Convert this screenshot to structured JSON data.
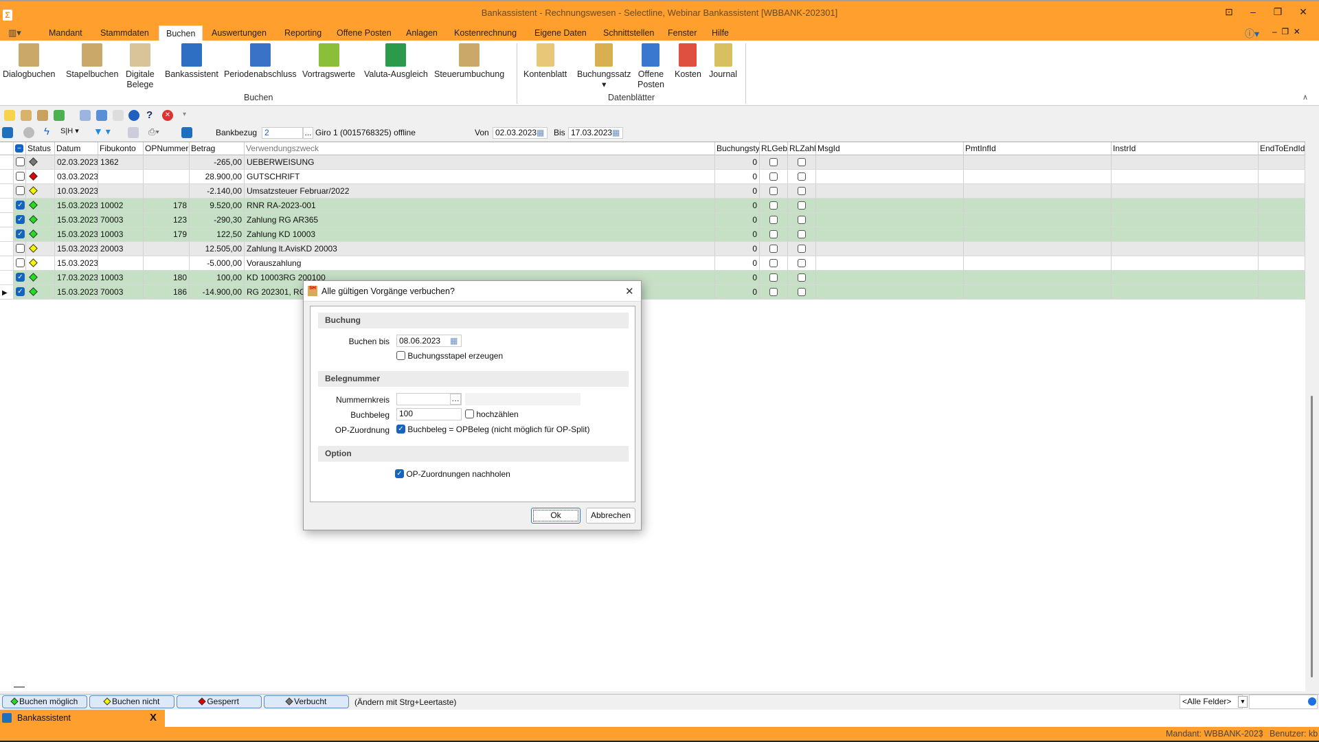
{
  "window": {
    "title": "Bankassistent - Rechnungswesen - Selectline, Webinar Bankassistent [WBBANK-202301]"
  },
  "menu": [
    "Mandant",
    "Stammdaten",
    "Buchen",
    "Auswertungen",
    "Reporting",
    "Offene Posten",
    "Anlagen",
    "Kostenrechnung",
    "Eigene Daten",
    "Schnittstellen",
    "Fenster",
    "Hilfe"
  ],
  "menu_active": "Buchen",
  "ribbon": {
    "buchen": [
      {
        "l1": "Dialogbuchen",
        "l2": ""
      },
      {
        "l1": "Stapelbuchen",
        "l2": ""
      },
      {
        "l1": "Digitale",
        "l2": "Belege"
      },
      {
        "l1": "Bankassistent",
        "l2": ""
      },
      {
        "l1": "Periodenabschluss",
        "l2": ""
      },
      {
        "l1": "Vortragswerte",
        "l2": ""
      },
      {
        "l1": "Valuta-Ausgleich",
        "l2": ""
      },
      {
        "l1": "Steuerumbuchung",
        "l2": ""
      }
    ],
    "buchen_group": "Buchen",
    "datenblaetter": [
      {
        "l1": "Kontenblatt",
        "l2": ""
      },
      {
        "l1": "Buchungssatz",
        "l2": "▾"
      },
      {
        "l1": "Offene",
        "l2": "Posten"
      },
      {
        "l1": "Kosten",
        "l2": ""
      },
      {
        "l1": "Journal",
        "l2": ""
      }
    ],
    "datenblaetter_group": "Datenblätter"
  },
  "filter": {
    "bankbezug_label": "Bankbezug",
    "bankbezug_value": "2",
    "bank_desc": "Giro 1 (0015768325) offline",
    "von_label": "Von",
    "von": "02.03.2023",
    "bis_label": "Bis",
    "bis": "17.03.2023",
    "browse": "..."
  },
  "table": {
    "columns": [
      "Status",
      "Datum",
      "Fibukonto",
      "OPNummer",
      "Betrag",
      "Verwendungszweck",
      "Buchungstyp",
      "RLGebühr",
      "RLZahlung",
      "MsgId",
      "PmtInfId",
      "InstrId",
      "EndToEndId"
    ],
    "rows": [
      {
        "checked": false,
        "status": "verbucht",
        "datum": "02.03.2023",
        "fibu": "1362",
        "op": "",
        "betrag": "-265,00",
        "zweck": "UEBERWEISUNG",
        "typ": "0"
      },
      {
        "checked": false,
        "status": "gesperrt",
        "datum": "03.03.2023",
        "fibu": "",
        "op": "",
        "betrag": "28.900,00",
        "zweck": "GUTSCHRIFT",
        "typ": "0"
      },
      {
        "checked": false,
        "status": "nicht-moeglich",
        "datum": "10.03.2023",
        "fibu": "",
        "op": "",
        "betrag": "-2.140,00",
        "zweck": "Umsatzsteuer Februar/2022",
        "typ": "0"
      },
      {
        "checked": true,
        "status": "moeglich",
        "datum": "15.03.2023",
        "fibu": "10002",
        "op": "178",
        "betrag": "9.520,00",
        "zweck": "RNR RA-2023-001",
        "typ": "0"
      },
      {
        "checked": true,
        "status": "moeglich",
        "datum": "15.03.2023",
        "fibu": "70003",
        "op": "123",
        "betrag": "-290,30",
        "zweck": "Zahlung RG AR365",
        "typ": "0"
      },
      {
        "checked": true,
        "status": "moeglich",
        "datum": "15.03.2023",
        "fibu": "10003",
        "op": "179",
        "betrag": "122,50",
        "zweck": "Zahlung KD 10003",
        "typ": "0"
      },
      {
        "checked": false,
        "status": "nicht-moeglich",
        "datum": "15.03.2023",
        "fibu": "20003",
        "op": "",
        "betrag": "12.505,00",
        "zweck": "Zahlung lt.AvisKD 20003",
        "typ": "0"
      },
      {
        "checked": false,
        "status": "nicht-moeglich",
        "datum": "15.03.2023",
        "fibu": "",
        "op": "",
        "betrag": "-5.000,00",
        "zweck": "Vorauszahlung",
        "typ": "0"
      },
      {
        "checked": true,
        "status": "moeglich",
        "datum": "17.03.2023",
        "fibu": "10003",
        "op": "180",
        "betrag": "100,00",
        "zweck": "KD 10003RG 200100",
        "typ": "0"
      },
      {
        "checked": true,
        "status": "moeglich",
        "datum": "15.03.2023",
        "fibu": "70003",
        "op": "186",
        "betrag": "-14.900,00",
        "zweck": "RG 202301, RG 2",
        "typ": "0",
        "current": true
      }
    ]
  },
  "status_colors": {
    "moeglich": "#22dd22",
    "nicht-moeglich": "#f5f500",
    "gesperrt": "#e00000",
    "verbucht": "#777777",
    "row_green": "#c6e0c6",
    "row_gray": "#e8e8e8",
    "accent": "#fe9f2e"
  },
  "legend": {
    "moeglich": "Buchen möglich",
    "nicht_moeglich": "Buchen nicht möglich",
    "gesperrt": "Gesperrt",
    "verbucht": "Verbucht",
    "hint": "(Ändern mit Strg+Leertaste)",
    "field_select": "<Alle Felder>"
  },
  "dialog": {
    "title": "Alle gültigen Vorgänge verbuchen?",
    "sec_buchung": "Buchung",
    "buchen_bis_label": "Buchen bis",
    "buchen_bis": "08.06.2023",
    "stapel_label": "Buchungsstapel erzeugen",
    "stapel_checked": false,
    "sec_beleg": "Belegnummer",
    "nummernkreis_label": "Nummernkreis",
    "nummernkreis": "",
    "buchbeleg_label": "Buchbeleg",
    "buchbeleg": "100",
    "hochzaehlen_label": "hochzählen",
    "hochzaehlen_checked": false,
    "opzuord_label": "OP-Zuordnung",
    "opzuord_text": "Buchbeleg = OPBeleg (nicht möglich für OP-Split)",
    "opzuord_checked": true,
    "sec_option": "Option",
    "nachholen_label": "OP-Zuordnungen nachholen",
    "nachholen_checked": true,
    "ok": "Ok",
    "cancel": "Abbrechen"
  },
  "tab": {
    "label": "Bankassistent",
    "close": "X"
  },
  "statusbar": {
    "mandant": "Mandant: WBBANK-2023",
    "benutzer": "Benutzer: kb"
  }
}
